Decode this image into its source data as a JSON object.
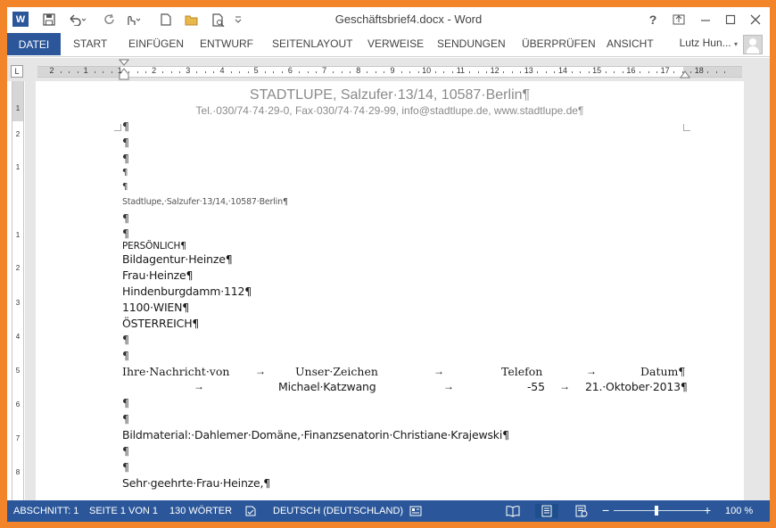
{
  "window": {
    "title": "Geschäftsbrief4.docx - Word",
    "help_icon": "?",
    "controls": [
      "ribbon-display-icon",
      "minimize-icon",
      "maximize-icon",
      "close-icon"
    ]
  },
  "quick_access": {
    "app_icon": "W",
    "items": [
      "save-icon",
      "undo-icon",
      "redo-icon",
      "touch-mode-icon",
      "new-document-icon",
      "open-icon",
      "print-preview-icon",
      "customize-icon"
    ]
  },
  "ribbon": {
    "file_tab": "DATEI",
    "tabs": [
      "START",
      "EINFÜGEN",
      "ENTWURF",
      "SEITENLAYOUT",
      "VERWEISE",
      "SENDUNGEN",
      "ÜBERPRÜFEN",
      "ANSICHT"
    ],
    "user_name": "Lutz Hun..."
  },
  "ruler": {
    "corner": "L",
    "numbers": [
      "2",
      "1",
      "1",
      "2",
      "3",
      "4",
      "5",
      "6",
      "7",
      "8",
      "9",
      "10",
      "11",
      "12",
      "13",
      "14",
      "15",
      "16",
      "17",
      "18"
    ],
    "vertical_numbers": [
      "1",
      "2",
      "1",
      "1",
      "2",
      "3",
      "4",
      "5",
      "6",
      "7",
      "8"
    ]
  },
  "document": {
    "header_line1": "STADTLUPE, Salzufer·13/14, 10587·Berlin¶",
    "header_line2": "Tel.·030/74·74·29-0, Fax·030/74·74·29-99, info@stadtlupe.de, www.stadtlupe.de¶",
    "pilcrow": "¶",
    "sender_line": "Stadtlupe,·Salzufer·13/14,·10587·Berlin¶",
    "address": [
      "PERSÖNLICH¶",
      "Bildagentur·Heinze¶",
      "Frau·Heinze¶",
      "Hindenburgdamm·112¶",
      "1100·WIEN¶",
      "ÖSTERREICH¶"
    ],
    "ref_labels": [
      "Ihre·Nachricht·von",
      "Unser·Zeichen",
      "Telefon",
      "Datum¶"
    ],
    "ref_values": [
      "Michael·Katzwang",
      "-55",
      "21.·Oktober·2013¶"
    ],
    "tab_arrow": "→",
    "subject": "Bildmaterial:·Dahlemer·Domäne,·Finanzsenatorin·Christiane·Krajewski¶",
    "salutation": "Sehr·geehrte·Frau·Heinze,¶"
  },
  "status": {
    "section": "ABSCHNITT: 1",
    "page": "SEITE 1 VON 1",
    "words": "130 WÖRTER",
    "language": "DEUTSCH (DEUTSCHLAND)",
    "zoom_minus": "−",
    "zoom_plus": "+",
    "zoom": "100 %",
    "zoom_level_percent": 100
  },
  "colors": {
    "accent": "#2b579a",
    "frame": "#f2842a"
  }
}
